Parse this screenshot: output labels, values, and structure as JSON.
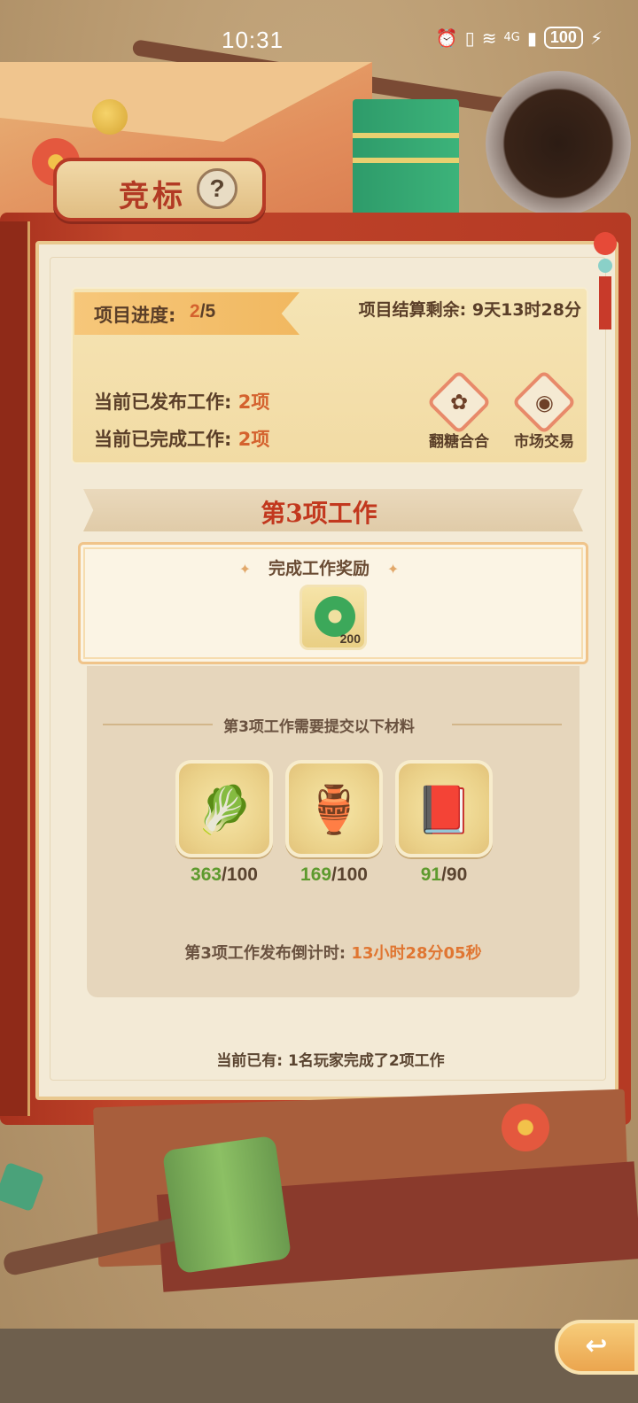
{
  "status_bar": {
    "time": "10:31",
    "network": "4G",
    "battery": "100"
  },
  "page": {
    "title": "竞标",
    "help_glyph": "?"
  },
  "progress": {
    "label": "项目进度:",
    "current": "2",
    "total": "/5",
    "settle_label": "项目结算剩余: 9天13时28分",
    "published_label": "当前已发布工作:",
    "published_value": "2项",
    "completed_label": "当前已完成工作:",
    "completed_value": "2项"
  },
  "shops": [
    {
      "label": "翻糖合合",
      "icon": "candy-icon"
    },
    {
      "label": "市场交易",
      "icon": "money-bag-icon"
    }
  ],
  "job": {
    "title": "第3项工作",
    "reward_title": "完成工作奖励",
    "reward_icon": "jade-ring-icon",
    "reward_count": "200",
    "materials_heading": "第3项工作需要提交以下材料",
    "materials": [
      {
        "icon": "radish-icon",
        "have": "363",
        "need": "/100"
      },
      {
        "icon": "bowl-icon",
        "have": "169",
        "need": "/100"
      },
      {
        "icon": "book-icon",
        "have": "91",
        "need": "/90"
      }
    ],
    "countdown_label": "第3项工作发布倒计时:",
    "countdown_value": "13小时28分05秒"
  },
  "players_line": "当前已有: 1名玩家完成了2项工作",
  "colors": {
    "accent_orange": "#d4622e",
    "have_green": "#5e9a2e",
    "title_red": "#c2381e"
  }
}
